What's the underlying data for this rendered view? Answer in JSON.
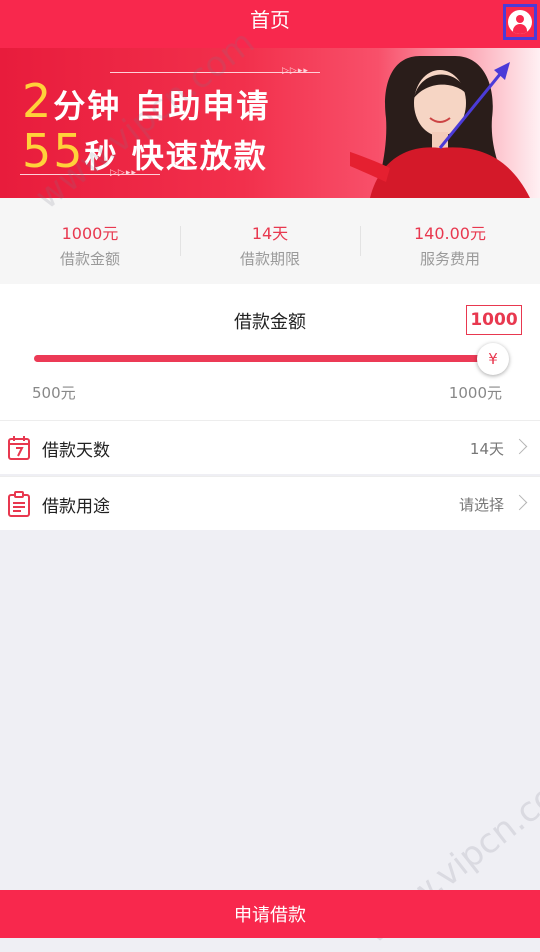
{
  "header": {
    "title": "首页"
  },
  "banner": {
    "line1_num": "2",
    "line1_text": "分钟 自助申请",
    "line2_num": "55",
    "line2_text": "秒 快速放款"
  },
  "summary": [
    {
      "value": "1000元",
      "label": "借款金额"
    },
    {
      "value": "14天",
      "label": "借款期限"
    },
    {
      "value": "140.00元",
      "label": "服务费用"
    }
  ],
  "amount": {
    "heading": "借款金额",
    "current_value": "1000",
    "slider_fraction": 1.0,
    "min_label": "500元",
    "max_label": "1000元",
    "thumb_symbol": "¥"
  },
  "rows": [
    {
      "label": "借款天数",
      "value": "14天",
      "icon": "calendar-icon"
    },
    {
      "label": "借款用途",
      "value": "请选择",
      "icon": "clipboard-icon"
    }
  ],
  "bottom_button": {
    "label": "申请借款"
  },
  "watermark": "www.vipcn.com",
  "colors": {
    "brand_red": "#f8284d",
    "accent_text": "#e8384f",
    "highlight_border": "#4b3bd8"
  }
}
